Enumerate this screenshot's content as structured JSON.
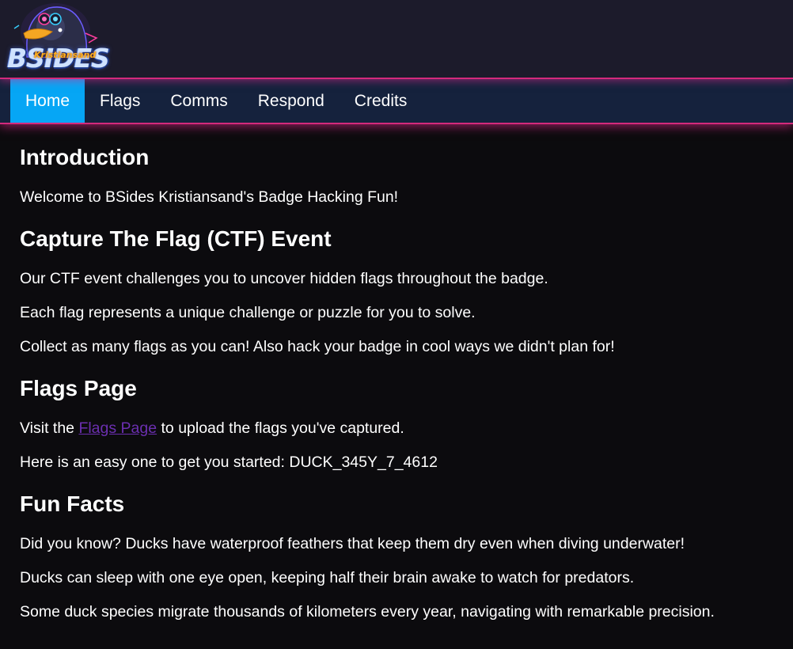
{
  "header": {
    "logo": {
      "title": "BSIDES",
      "subtitle": "Kristiansand",
      "icon": "duck-mascot-icon"
    }
  },
  "nav": {
    "items": [
      {
        "label": "Home",
        "active": true
      },
      {
        "label": "Flags",
        "active": false
      },
      {
        "label": "Comms",
        "active": false
      },
      {
        "label": "Respond",
        "active": false
      },
      {
        "label": "Credits",
        "active": false
      }
    ]
  },
  "intro": {
    "heading": "Introduction",
    "text": "Welcome to BSides Kristiansand's Badge Hacking Fun!"
  },
  "ctf": {
    "heading": "Capture The Flag (CTF) Event",
    "p1": "Our CTF event challenges you to uncover hidden flags throughout the badge.",
    "p2": "Each flag represents a unique challenge or puzzle for you to solve.",
    "p3": "Collect as many flags as you can! Also hack your badge in cool ways we didn't plan for!"
  },
  "flags_page": {
    "heading": "Flags Page",
    "visit_prefix": "Visit the ",
    "link_label": "Flags Page",
    "visit_suffix": " to upload the flags you've captured.",
    "easy": "Here is an easy one to get you started: DUCK_345Y_7_4612"
  },
  "fun_facts": {
    "heading": "Fun Facts",
    "f1": "Did you know? Ducks have waterproof feathers that keep them dry even when diving underwater!",
    "f2": "Ducks can sleep with one eye open, keeping half their brain awake to watch for predators.",
    "f3": "Some duck species migrate thousands of kilometers every year, navigating with remarkable precision."
  },
  "colors": {
    "accent_active": "#06a6f5",
    "neon_border": "#d42a7c",
    "link": "#6b2fb0",
    "nav_bg": "#15223d",
    "header_bg": "#1c1b2b",
    "page_bg": "#0c0b0e"
  }
}
